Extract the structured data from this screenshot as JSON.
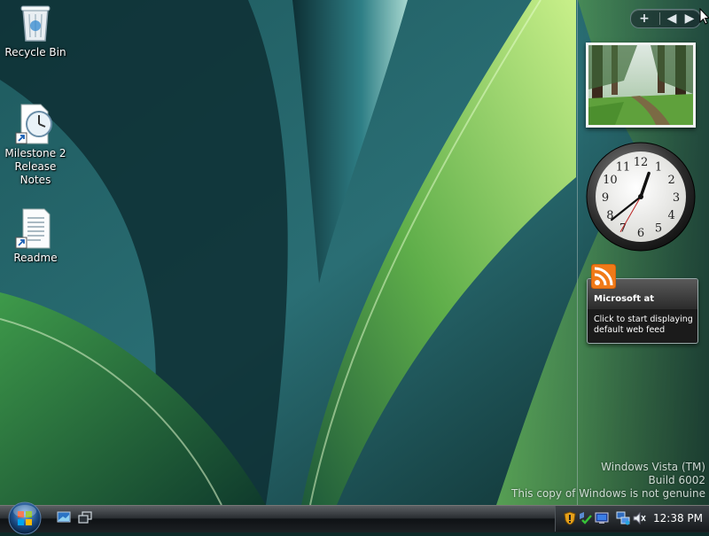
{
  "desktop_icons": [
    {
      "label": "Recycle Bin",
      "icon": "recycle-bin-icon"
    },
    {
      "label": "Milestone 2\nRelease Notes",
      "icon": "release-notes-shortcut-icon"
    },
    {
      "label": "Readme",
      "icon": "readme-shortcut-icon"
    }
  ],
  "sidebar": {
    "toolbar": {
      "add_label": "+",
      "prev_label": "◀",
      "next_label": "▶"
    },
    "feed": {
      "title": "Microsoft at",
      "body": "Click to start displaying default web feed",
      "icon": "rss-icon"
    },
    "clock": {
      "hour": 12,
      "minute": 38,
      "second": 35,
      "numbers": [
        "12",
        "1",
        "2",
        "3",
        "4",
        "5",
        "6",
        "7",
        "8",
        "9",
        "10",
        "11"
      ]
    },
    "slideshow": {
      "icon": "forest-photo"
    }
  },
  "watermark": {
    "line1": "Windows Vista (TM)",
    "line2": "Build 6002",
    "line3": "This copy of Windows is not genuine"
  },
  "taskbar": {
    "start_icon": "windows-start-orb-icon",
    "quick_launch": [
      "show-desktop-icon",
      "switch-windows-icon"
    ],
    "tray_icons": [
      "security-alert-icon",
      "update-check-icon",
      "display-icon",
      "network-icon",
      "volume-icon"
    ],
    "clock": "12:38 PM"
  },
  "colors": {
    "taskbar_dark": "#0f1215",
    "feed_orange": "#f07a18",
    "wallpaper_green": "#7ec84a"
  }
}
